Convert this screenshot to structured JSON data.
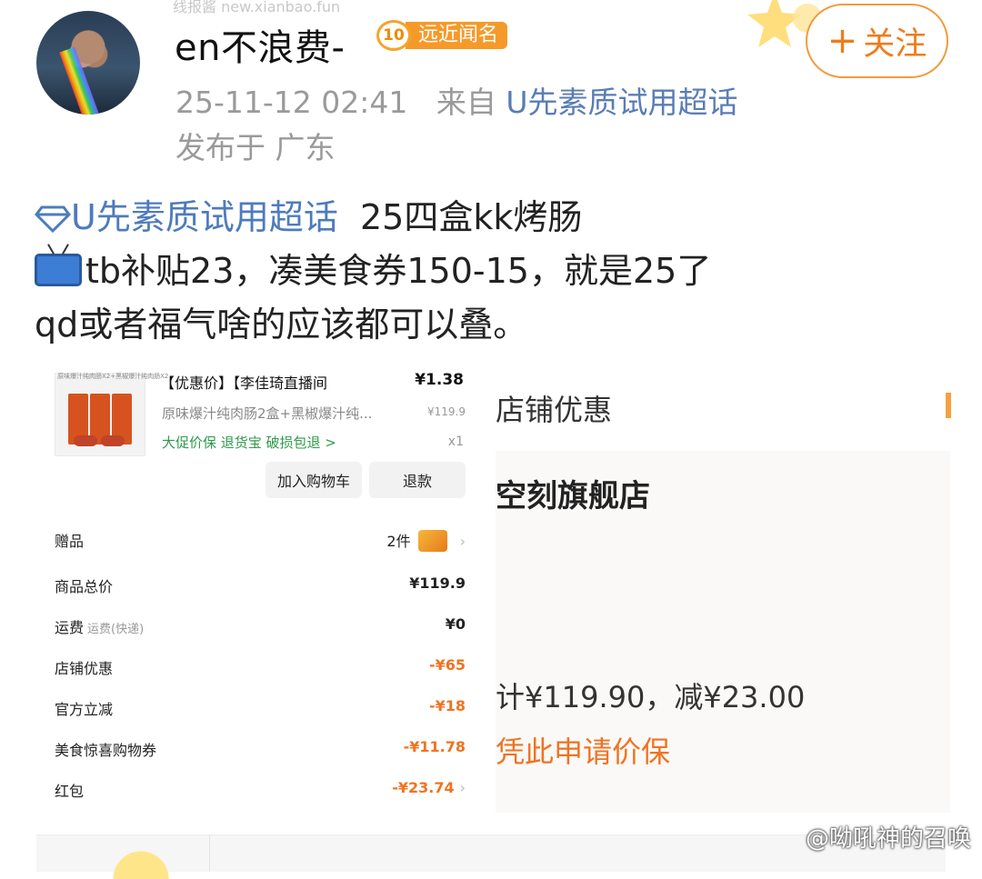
{
  "top_faded_text": "线报酱 new.xianbao.fun",
  "author": {
    "name": "en不浪费-",
    "level": "10",
    "badge": "远近闻名"
  },
  "meta": {
    "timestamp": "25-11-12 02:41",
    "from_prefix": "来自",
    "source": "U先素质试用超话",
    "location": "发布于 广东"
  },
  "follow": {
    "plus": "+",
    "label": "关注"
  },
  "post": {
    "topic": "U先素质试用超话",
    "line1_text": "25四盒kk烤肠",
    "line2_text": "tb补贴23，凑美食券150-15，就是25了",
    "line3_text": "qd或者福气啥的应该都可以叠。"
  },
  "left_shot": {
    "thumb_tag": "原味爆汁纯肉肠X2+黑椒爆汁纯肉肠X2",
    "title": "【优惠价】【李佳琦直播间",
    "price": "¥1.38",
    "spec": "原味爆汁纯肉肠2盒+黑椒爆汁纯...",
    "spec_price": "¥119.9",
    "guarantee": "大促价保  退货宝  破损包退 >",
    "qty": "x1",
    "btn_cart": "加入购物车",
    "btn_refund": "退款",
    "rows": [
      {
        "label": "赠品",
        "sub": "",
        "value": "2件",
        "orange": false
      },
      {
        "label": "商品总价",
        "sub": "",
        "value": "¥119.9",
        "orange": false
      },
      {
        "label": "运费",
        "sub": "运费(快递)",
        "value": "¥0",
        "orange": false
      },
      {
        "label": "店铺优惠",
        "sub": "",
        "value": "-¥65",
        "orange": true
      },
      {
        "label": "官方立减",
        "sub": "",
        "value": "-¥18",
        "orange": true
      },
      {
        "label": "美食惊喜购物券",
        "sub": "",
        "value": "-¥11.78",
        "orange": true
      },
      {
        "label": "红包",
        "sub": "",
        "value": "-¥23.74",
        "orange": true
      }
    ]
  },
  "right_shot": {
    "header": "店铺优惠",
    "store": "空刻旗舰店",
    "total": "计¥119.90，减¥23.00",
    "apply": "凭此申请价保"
  },
  "watermark": "@呦吼神的召唤",
  "colors": {
    "accent_orange": "#f07320",
    "topic_blue": "#4e7bbd",
    "guarantee_green": "#2e9a4a"
  }
}
